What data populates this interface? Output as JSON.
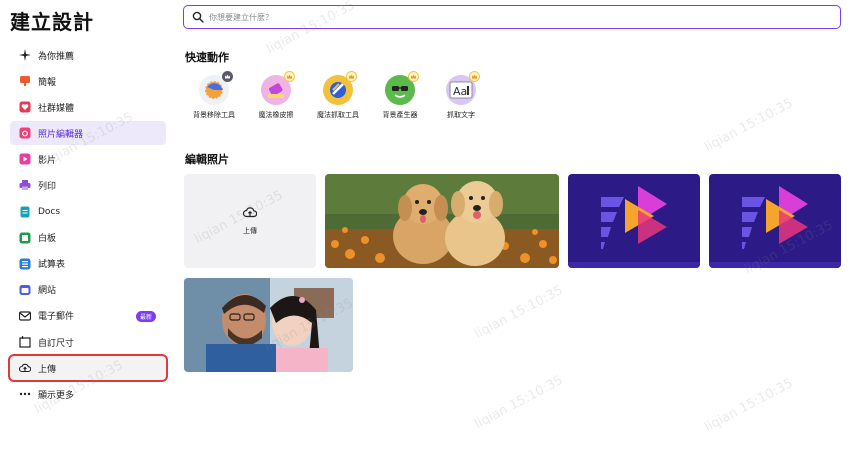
{
  "brand": "建立設計",
  "search": {
    "placeholder": "你想要建立什麼？"
  },
  "sidebar": {
    "items": [
      {
        "label": "為你推薦",
        "icon": "sparkle-icon",
        "color": "#222222"
      },
      {
        "label": "簡報",
        "icon": "presentation-icon",
        "color": "#f0592a"
      },
      {
        "label": "社群媒體",
        "icon": "heart-icon",
        "color": "#e7394f"
      },
      {
        "label": "照片編輯器",
        "icon": "photo-editor-icon",
        "color": "#e9437a"
      },
      {
        "label": "影片",
        "icon": "video-icon",
        "color": "#e63fa0"
      },
      {
        "label": "列印",
        "icon": "print-icon",
        "color": "#8b4fd9"
      },
      {
        "label": "Docs",
        "icon": "docs-icon",
        "color": "#15a3b8"
      },
      {
        "label": "白板",
        "icon": "whiteboard-icon",
        "color": "#1e9b4b"
      },
      {
        "label": "試算表",
        "icon": "spreadsheet-icon",
        "color": "#2a7bd8"
      },
      {
        "label": "網站",
        "icon": "website-icon",
        "color": "#4b5fd8"
      },
      {
        "label": "電子郵件",
        "icon": "email-icon",
        "color": "#222222",
        "badge": "最新"
      },
      {
        "label": "自訂尺寸",
        "icon": "custom-size-icon",
        "color": "#222222"
      },
      {
        "label": "上傳",
        "icon": "upload-cloud-icon",
        "color": "#222222"
      },
      {
        "label": "顯示更多",
        "icon": "more-icon",
        "color": "#222222"
      }
    ]
  },
  "quick_actions": {
    "title": "快速動作",
    "items": [
      {
        "label": "背景移除工具",
        "icon": "background-remover-icon"
      },
      {
        "label": "魔法橡皮擦",
        "icon": "magic-eraser-icon"
      },
      {
        "label": "魔法抓取工具",
        "icon": "magic-grab-icon"
      },
      {
        "label": "背景產生器",
        "icon": "background-generator-icon"
      },
      {
        "label": "抓取文字",
        "icon": "grab-text-icon"
      }
    ]
  },
  "edit_photos": {
    "title": "編輯照片",
    "upload_label": "上傳",
    "tiles": [
      "two-golden-retriever-puppies-photo",
      "video-editor-logo-image",
      "video-editor-logo-image",
      "couple-kissing-photo"
    ]
  },
  "watermark": "liqian 15:10:35",
  "colors": {
    "accent": "#7d3cf2",
    "highlight_border": "#e0393c"
  }
}
